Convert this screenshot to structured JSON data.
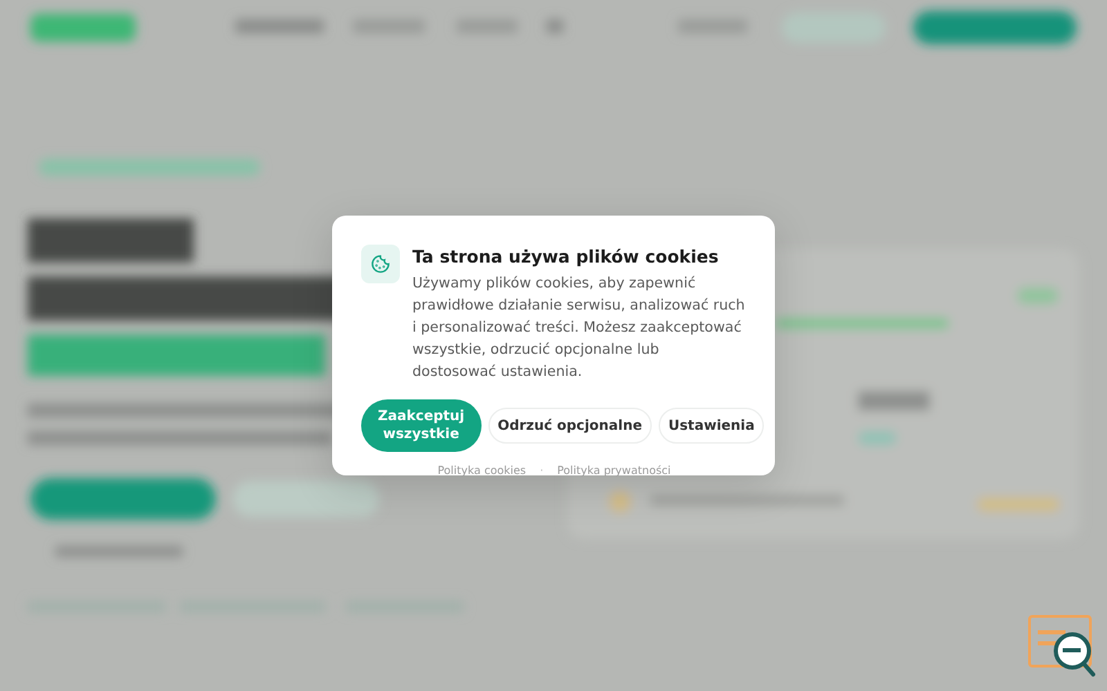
{
  "cookie_dialog": {
    "title": "Ta strona używa plików cookies",
    "body": "Używamy plików cookies, aby zapewnić prawidłowe działanie serwisu, analizować ruch i personalizować treści. Możesz zaakceptować wszystkie, odrzucić opcjonalne lub dostosować ustawienia.",
    "buttons": [
      {
        "label": "Zaakceptuj wszystkie",
        "kind": "primary"
      },
      {
        "label": "Odrzuć opcjonalne",
        "kind": "secondary"
      },
      {
        "label": "Ustawienia",
        "kind": "secondary"
      }
    ],
    "links": [
      "Polityka cookies",
      "Polityka prywatności"
    ],
    "separator": "·"
  }
}
